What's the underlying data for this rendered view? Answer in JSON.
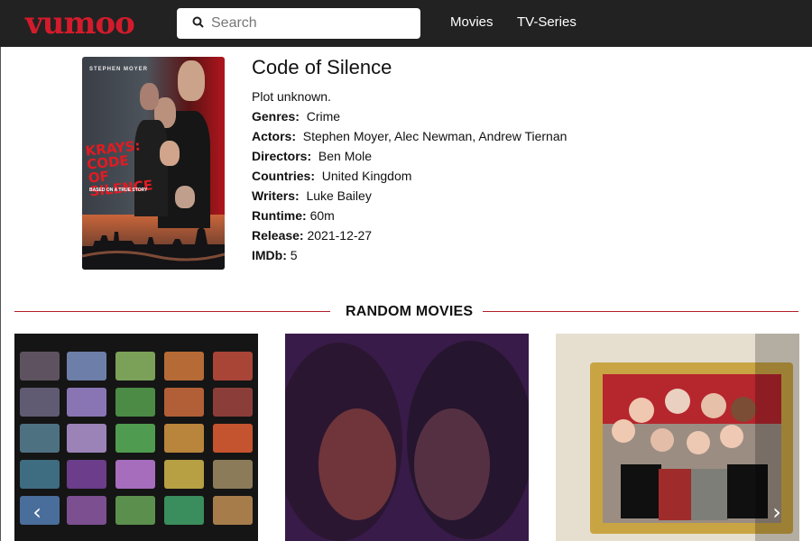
{
  "header": {
    "logo": "vumoo",
    "search": {
      "placeholder": "Search",
      "value": ""
    },
    "nav": [
      {
        "label": "Movies"
      },
      {
        "label": "TV-Series"
      }
    ]
  },
  "movie": {
    "title": "Code of Silence",
    "plot": "Plot unknown.",
    "details": [
      {
        "label": "Genres:",
        "value": "Crime"
      },
      {
        "label": "Actors:",
        "value": "Stephen Moyer, Alec Newman, Andrew Tiernan"
      },
      {
        "label": "Directors:",
        "value": "Ben Mole"
      },
      {
        "label": "Countries:",
        "value": "United Kingdom"
      },
      {
        "label": "Writers:",
        "value": "Luke Bailey"
      },
      {
        "label": "Runtime:",
        "value": "60m"
      },
      {
        "label": "Release:",
        "value": "2021-12-27"
      },
      {
        "label": "IMDb:",
        "value": "5"
      }
    ],
    "poster": {
      "actor": "STEPHEN MOYER",
      "title": "KRAYS: CODE OF SILENCE",
      "tagline": "BASED ON A TRUE STORY"
    }
  },
  "random": {
    "heading": "RANDOM MOVIES"
  },
  "carousel": {
    "prev_icon": "‹",
    "next_icon": "›"
  },
  "colors": {
    "accent": "#d31b2c",
    "header_bg": "#222222",
    "divider": "#b31d28"
  }
}
